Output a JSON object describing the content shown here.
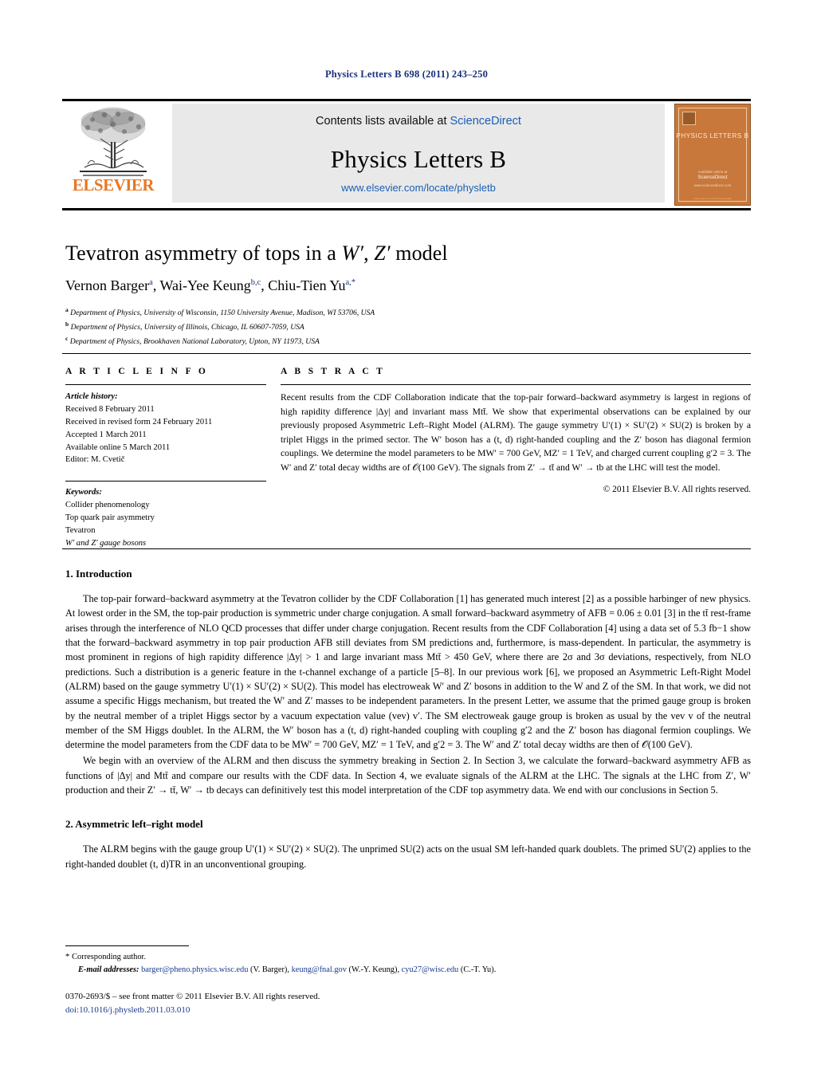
{
  "journal_ref": "Physics Letters B 698 (2011) 243–250",
  "masthead": {
    "contents_prefix": "Contents lists available at ",
    "sciencedirect": "ScienceDirect",
    "journal_title": "Physics Letters B",
    "journal_url": "www.elsevier.com/locate/physletb",
    "publisher": "ELSEVIER",
    "accent_orange": "#e87722",
    "link_blue": "#1a5fb4",
    "cover": {
      "title": "PHYSICS LETTERS B",
      "foot_small": "Available online at",
      "foot_big": "ScienceDirect",
      "foot_url": "www.sciencedirect.com",
      "bottom": "www.elsevier.com/locate/physletb",
      "bg": "#c8783a"
    }
  },
  "article": {
    "title_plain": "Tevatron asymmetry of tops in a ",
    "title_w": "W′",
    "title_mid": ", ",
    "title_z": "Z′",
    "title_end": " model",
    "authors": [
      {
        "name": "Vernon Barger",
        "marks": "a"
      },
      {
        "name": "Wai-Yee Keung",
        "marks": "b,c"
      },
      {
        "name": "Chiu-Tien Yu",
        "marks": "a,*"
      }
    ],
    "affiliations": [
      {
        "mark": "a",
        "text": "Department of Physics, University of Wisconsin, 1150 University Avenue, Madison, WI 53706, USA"
      },
      {
        "mark": "b",
        "text": "Department of Physics, University of Illinois, Chicago, IL 60607-7059, USA"
      },
      {
        "mark": "c",
        "text": "Department of Physics, Brookhaven National Laboratory, Upton, NY 11973, USA"
      }
    ]
  },
  "info": {
    "heading": "A R T I C L E    I N F O",
    "history_label": "Article history:",
    "history": [
      "Received 8 February 2011",
      "Received in revised form 24 February 2011",
      "Accepted 1 March 2011",
      "Available online 5 March 2011",
      "Editor: M. Cvetič"
    ],
    "keywords_label": "Keywords:",
    "keywords": [
      "Collider phenomenology",
      "Top quark pair asymmetry",
      "Tevatron",
      "W′ and Z′ gauge bosons"
    ]
  },
  "abstract": {
    "heading": "A B S T R A C T",
    "text": "Recent results from the CDF Collaboration indicate that the top-pair forward–backward asymmetry is largest in regions of high rapidity difference |Δy| and invariant mass Mtt̄. We show that experimental observations can be explained by our previously proposed Asymmetric Left–Right Model (ALRM). The gauge symmetry U′(1) × SU′(2) × SU(2) is broken by a triplet Higgs in the primed sector. The W′ boson has a (t, d) right-handed coupling and the Z′ boson has diagonal fermion couplings. We determine the model parameters to be MW′ = 700 GeV, MZ′ = 1 TeV, and charged current coupling g′2 = 3. The W′ and Z′ total decay widths are of 𝒪(100 GeV). The signals from Z′ → tt̄ and W′ → tb at the LHC will test the model.",
    "copyright": "© 2011 Elsevier B.V. All rights reserved."
  },
  "sections": [
    {
      "heading": "1. Introduction",
      "paragraphs": [
        "The top-pair forward–backward asymmetry at the Tevatron collider by the CDF Collaboration [1] has generated much interest [2] as a possible harbinger of new physics. At lowest order in the SM, the top-pair production is symmetric under charge conjugation. A small forward–backward asymmetry of AFB = 0.06 ± 0.01 [3] in the tt̄ rest-frame arises through the interference of NLO QCD processes that differ under charge conjugation. Recent results from the CDF Collaboration [4] using a data set of 5.3 fb−1 show that the forward–backward asymmetry in top pair production AFB still deviates from SM predictions and, furthermore, is mass-dependent. In particular, the asymmetry is most prominent in regions of high rapidity difference |Δy| > 1 and large invariant mass Mtt̄ > 450 GeV, where there are 2σ and 3σ deviations, respectively, from NLO predictions. Such a distribution is a generic feature in the t-channel exchange of a particle [5–8]. In our previous work [6], we proposed an Asymmetric Left-Right Model (ALRM) based on the gauge symmetry U′(1) × SU′(2) × SU(2). This model has electroweak W′ and Z′ bosons in addition to the W and Z of the SM. In that work, we did not assume a specific Higgs mechanism, but treated the W′ and Z′ masses to be independent parameters. In the present Letter, we assume that the primed gauge group is broken by the neutral member of a triplet Higgs sector by a vacuum expectation value (vev) v′. The SM electroweak gauge group is broken as usual by the vev v of the neutral member of the SM Higgs doublet. In the ALRM, the W′ boson has a (t, d) right-handed coupling with coupling g′2 and the Z′ boson has diagonal fermion couplings. We determine the model parameters from the CDF data to be MW′ = 700 GeV, MZ′ = 1 TeV, and g′2 = 3. The W′ and Z′ total decay widths are then of 𝒪(100 GeV).",
        "We begin with an overview of the ALRM and then discuss the symmetry breaking in Section 2. In Section 3, we calculate the forward–backward asymmetry AFB as functions of |Δy| and Mtt̄ and compare our results with the CDF data. In Section 4, we evaluate signals of the ALRM at the LHC. The signals at the LHC from Z′, W′ production and their Z′ → tt̄, W′ → tb decays can definitively test this model interpretation of the CDF top asymmetry data. We end with our conclusions in Section 5."
      ]
    },
    {
      "heading": "2. Asymmetric left–right model",
      "paragraphs": [
        "The ALRM begins with the gauge group U′(1) × SU′(2) × SU(2). The unprimed SU(2) acts on the usual SM left-handed quark doublets. The primed SU′(2) applies to the right-handed doublet (t, d)TR in an unconventional grouping."
      ]
    }
  ],
  "footnotes": {
    "corresponding_mark": "*",
    "corresponding_text": "Corresponding author.",
    "email_label": "E-mail addresses:",
    "emails": [
      {
        "address": "barger@pheno.physics.wisc.edu",
        "who": "(V. Barger)"
      },
      {
        "address": "keung@fnal.gov",
        "who": "(W.-Y. Keung)"
      },
      {
        "address": "cyu27@wisc.edu",
        "who": "(C.-T. Yu)"
      }
    ]
  },
  "imprint": {
    "line1": "0370-2693/$ – see front matter © 2011 Elsevier B.V. All rights reserved.",
    "doi": "doi:10.1016/j.physletb.2011.03.010"
  }
}
